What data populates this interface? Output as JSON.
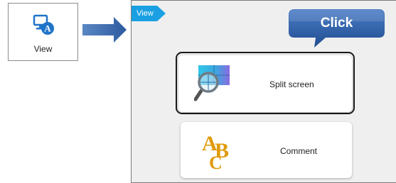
{
  "view_tile": {
    "label": "View",
    "icon": "monitor-with-text-icon"
  },
  "panel": {
    "tag": "View",
    "callout": {
      "label": "Click"
    },
    "options": [
      {
        "label": "Split screen",
        "icon": "split-screen-magnifier-icon"
      },
      {
        "label": "Comment",
        "icon": "abc-comment-icon"
      }
    ]
  },
  "colors": {
    "tag_blue": "#1aa0e2",
    "callout_blue": "#1f4d8f",
    "arrow_blue": "#2c5a9e",
    "focus_ring": "#1a1a1a",
    "abc_gold": "#e09a0c"
  }
}
